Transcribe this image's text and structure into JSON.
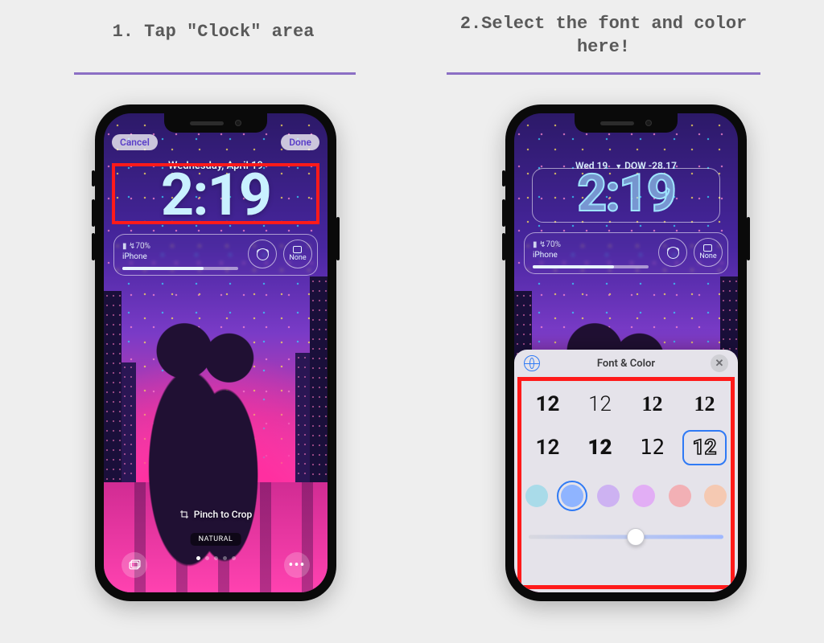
{
  "captions": {
    "step1": "1. Tap \"Clock\" area",
    "step2": "2.Select the font and color here!"
  },
  "accent_color": "#8b6fc4",
  "highlight_color": "#ff1a1a",
  "phone1": {
    "cancel": "Cancel",
    "done": "Done",
    "date": "Wednesday, April 19",
    "clock": "2:19",
    "battery": {
      "percent": "70%",
      "device": "iPhone",
      "icon_bolt": "↯"
    },
    "widgets": {
      "none": "None"
    },
    "crop_hint": "Pinch to Crop",
    "mode_chip": "NATURAL",
    "page_dots": {
      "count": 5,
      "active": 0
    }
  },
  "phone2": {
    "date_short": "Wed 19",
    "dow_arrow": "▼",
    "dow_label": "DOW",
    "dow_value": "-28.17",
    "clock": "2:19",
    "battery": {
      "percent": "70%",
      "device": "iPhone",
      "icon_bolt": "↯"
    },
    "widgets": {
      "none": "None"
    },
    "sheet": {
      "title": "Font & Color",
      "font_sample": "12",
      "font_styles": [
        "bold",
        "thin",
        "serif",
        "slab",
        "reg",
        "heavy",
        "mono",
        "outline"
      ],
      "selected_font_index": 7,
      "colors": [
        "#a9dbe9",
        "#8fb4ff",
        "#cdb2f2",
        "#e2aef5",
        "#f2b0b5",
        "#f5c9b2"
      ],
      "selected_color_index": 1,
      "slider_value": 0.55
    }
  }
}
